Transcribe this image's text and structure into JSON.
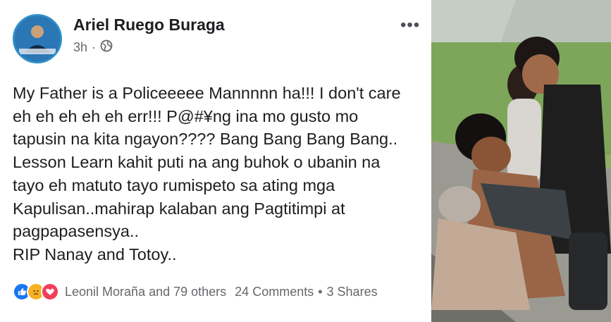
{
  "post": {
    "author": "Ariel Ruego Buraga",
    "time": "3h",
    "dot": "·",
    "privacy_icon": "globe-icon",
    "more_label": "•••",
    "lines": [
      "My Father is a Policeeeee Mannnnn ha!!! I don't care",
      "eh eh eh eh eh err!!! P@#¥ng ina mo gusto mo",
      "tapusin na kita ngayon???? Bang Bang Bang Bang..",
      "Lesson Learn kahit puti na ang buhok o ubanin na",
      "tayo eh matuto tayo rumispeto sa ating mga",
      "Kapulisan..mahirap kalaban ang Pagtitimpi at",
      "pagpapasensya..",
      "RIP Nanay and Totoy.."
    ],
    "reactions": {
      "icons": [
        "like-icon",
        "sad-icon",
        "love-icon"
      ],
      "summary": "Leonil Moraña and 79 others",
      "comments": "24 Comments",
      "separator": "•",
      "shares": "3 Shares"
    }
  },
  "colors": {
    "text": "#1c1e21",
    "muted": "#65676b",
    "like": "#1877f2",
    "sad": "#f7b125",
    "love": "#f33e58"
  }
}
